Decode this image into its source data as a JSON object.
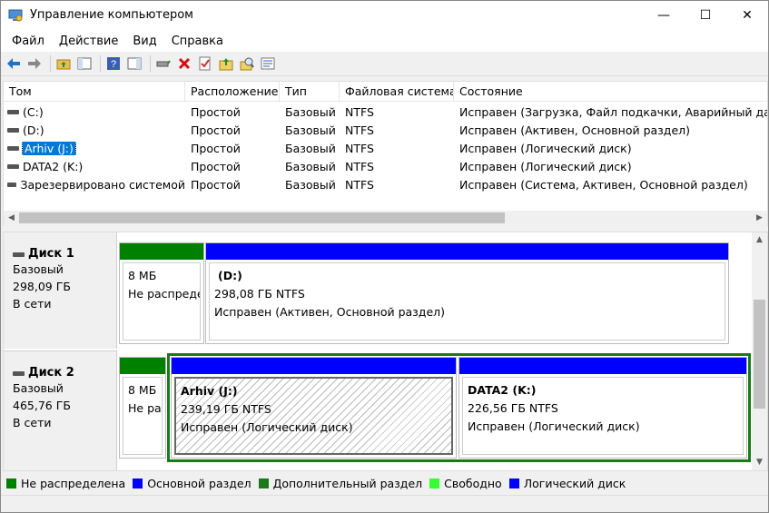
{
  "window": {
    "title": "Управление компьютером",
    "controls": {
      "minimize": "—",
      "maximize": "☐",
      "close": "✕"
    }
  },
  "menu": [
    "Файл",
    "Действие",
    "Вид",
    "Справка"
  ],
  "toolbar_icons": [
    "back-icon",
    "forward-icon",
    "up-folder-icon",
    "show-hide-tree-icon",
    "help-icon",
    "properties-pane-icon",
    "connect-icon",
    "delete-icon",
    "check-icon",
    "open-folder-icon",
    "search-icon",
    "settings-icon"
  ],
  "volumes": {
    "columns": [
      "Том",
      "Расположение",
      "Тип",
      "Файловая система",
      "Состояние"
    ],
    "rows": [
      {
        "name": "(C:)",
        "location": "Простой",
        "type": "Базовый",
        "fs": "NTFS",
        "status": "Исправен (Загрузка, Файл подкачки, Аварийный дамп"
      },
      {
        "name": "(D:)",
        "location": "Простой",
        "type": "Базовый",
        "fs": "NTFS",
        "status": "Исправен (Активен, Основной раздел)"
      },
      {
        "name": "Arhiv (J:)",
        "location": "Простой",
        "type": "Базовый",
        "fs": "NTFS",
        "status": "Исправен (Логический диск)"
      },
      {
        "name": "DATA2 (K:)",
        "location": "Простой",
        "type": "Базовый",
        "fs": "NTFS",
        "status": "Исправен (Логический диск)"
      },
      {
        "name": "Зарезервировано системой",
        "location": "Простой",
        "type": "Базовый",
        "fs": "NTFS",
        "status": "Исправен (Система, Активен, Основной раздел)"
      }
    ]
  },
  "disks": [
    {
      "name": "Диск 1",
      "type": "Базовый",
      "size": "298,09 ГБ",
      "state": "В сети",
      "partitions": [
        {
          "size": "8 МБ",
          "label": "Не распределена"
        },
        {
          "title": "(D:)",
          "size": "298,08 ГБ NTFS",
          "status": "Исправен (Активен, Основной раздел)"
        }
      ]
    },
    {
      "name": "Диск 2",
      "type": "Базовый",
      "size": "465,76 ГБ",
      "state": "В сети",
      "partitions": [
        {
          "size": "8 МБ",
          "label": "Не распределена"
        },
        {
          "title": "Arhiv  (J:)",
          "size": "239,19 ГБ NTFS",
          "status": "Исправен (Логический диск)"
        },
        {
          "title": "DATA2  (K:)",
          "size": "226,56 ГБ NTFS",
          "status": "Исправен (Логический диск)"
        }
      ]
    }
  ],
  "legend": [
    {
      "label": "Не распределена",
      "color": "#008000"
    },
    {
      "label": "Основной раздел",
      "color": "#0000ff"
    },
    {
      "label": "Дополнительный раздел",
      "color": "#1a7a1a"
    },
    {
      "label": "Свободно",
      "color": "#33ff33"
    },
    {
      "label": "Логический диск",
      "color": "#0000ff"
    }
  ],
  "colors": {
    "unallocated": "#008000",
    "primary": "#0000ff",
    "extended": "#1a7a1a",
    "selection": "#0078d7"
  }
}
